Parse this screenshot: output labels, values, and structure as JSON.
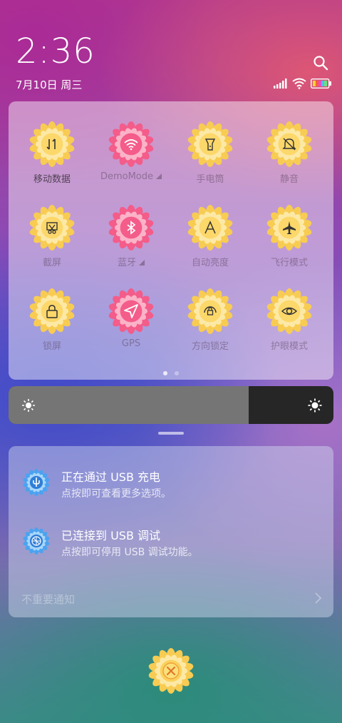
{
  "status_bar": {
    "time": "2:36",
    "date": "7月10日 周三",
    "icons": [
      "signal-icon",
      "wifi-icon",
      "battery-icon"
    ]
  },
  "quick_settings": {
    "page_count": 2,
    "active_page": 1,
    "tiles": [
      {
        "label": "移动数据",
        "icon": "mobile-data-icon",
        "state": "on"
      },
      {
        "label": "DemoMode",
        "icon": "wifi-icon",
        "state": "active",
        "expand": true
      },
      {
        "label": "手电筒",
        "icon": "flashlight-icon",
        "state": "off"
      },
      {
        "label": "静音",
        "icon": "mute-icon",
        "state": "off"
      },
      {
        "label": "截屏",
        "icon": "screenshot-icon",
        "state": "off"
      },
      {
        "label": "蓝牙",
        "icon": "bluetooth-icon",
        "state": "active",
        "expand": true
      },
      {
        "label": "自动亮度",
        "icon": "auto-brightness-icon",
        "state": "off"
      },
      {
        "label": "飞行模式",
        "icon": "airplane-icon",
        "state": "off"
      },
      {
        "label": "锁屏",
        "icon": "lock-icon",
        "state": "off"
      },
      {
        "label": "GPS",
        "icon": "location-icon",
        "state": "active"
      },
      {
        "label": "方向锁定",
        "icon": "rotation-lock-icon",
        "state": "off"
      },
      {
        "label": "护眼模式",
        "icon": "eye-icon",
        "state": "off"
      }
    ]
  },
  "brightness": {
    "level": 0.74
  },
  "notifications": {
    "items": [
      {
        "title": "正在通过 USB 充电",
        "subtitle": "点按即可查看更多选项。",
        "icon": "usb-icon"
      },
      {
        "title": "已连接到 USB 调试",
        "subtitle": "点按即可停用 USB 调试功能。",
        "icon": "debug-icon"
      }
    ],
    "unimportant_label": "不重要通知"
  },
  "colors": {
    "yellow_flower": "#f8cc52",
    "pink_flower": "#f45c8a",
    "blue_flower": "#3a8ee8"
  }
}
